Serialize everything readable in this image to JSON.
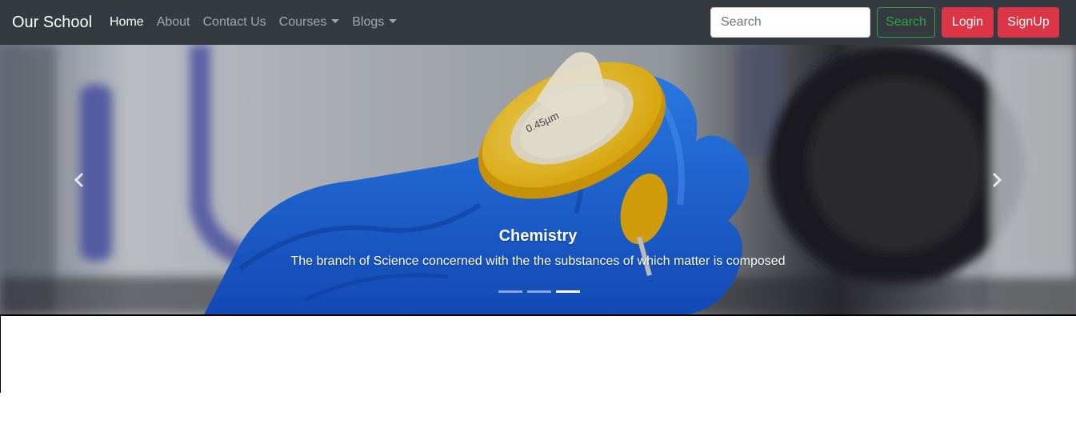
{
  "navbar": {
    "brand": "Our School",
    "links": [
      {
        "label": "Home",
        "active": true
      },
      {
        "label": "About"
      },
      {
        "label": "Contact Us"
      },
      {
        "label": "Courses",
        "dropdown": true
      },
      {
        "label": "Blogs",
        "dropdown": true
      }
    ],
    "search_placeholder": "Search",
    "search_button": "Search",
    "login_button": "Login",
    "signup_button": "SignUp"
  },
  "carousel": {
    "slide_count": 3,
    "active_slide": 3,
    "caption_title": "Chemistry",
    "caption_text": "The branch of Science concerned with the the substances of which matter is composed",
    "syringe_label": "0.45µm"
  },
  "colors": {
    "navbar_bg": "#343a40",
    "search_green": "#28a745",
    "danger_red": "#dc3545",
    "glove_blue": "#1d6fe0",
    "filter_yellow": "#f5c518"
  }
}
